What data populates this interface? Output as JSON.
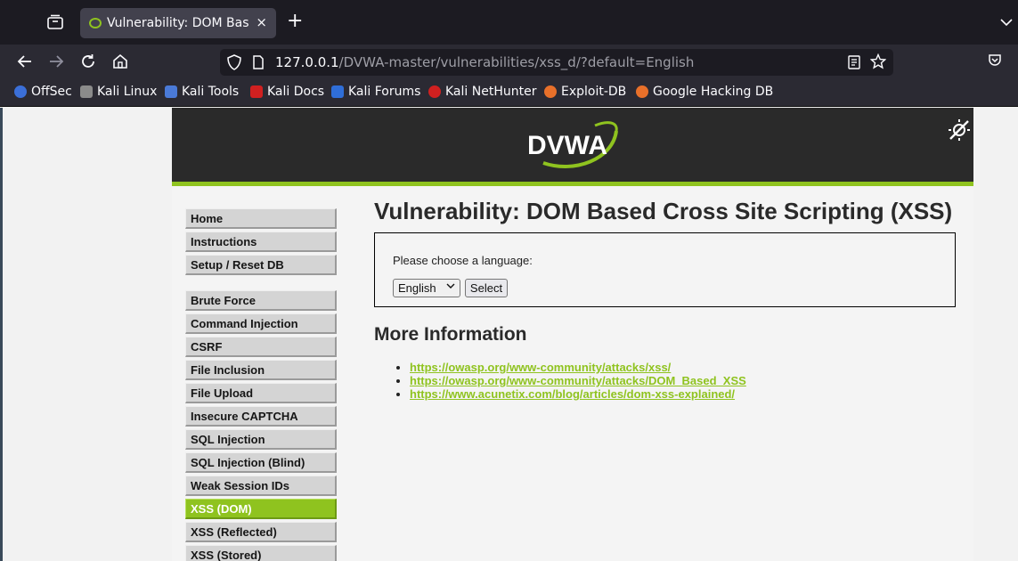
{
  "browser": {
    "tab_title": "Vulnerability: DOM Based Cross Site Scripting (XSS)",
    "url_host": "127.0.0.1",
    "url_path": "/DVWA-master/vulnerabilities/xss_d/?default=English",
    "new_tab_label": "+",
    "close_tab_label": "×"
  },
  "bookmarks": [
    {
      "label": "OffSec",
      "color": "#3b6fd8"
    },
    {
      "label": "Kali Linux",
      "color": "#8b8b8b"
    },
    {
      "label": "Kali Tools",
      "color": "#4a7ad8"
    },
    {
      "label": "Kali Docs",
      "color": "#d02020"
    },
    {
      "label": "Kali Forums",
      "color": "#2f6ed8"
    },
    {
      "label": "Kali NetHunter",
      "color": "#d02020"
    },
    {
      "label": "Exploit-DB",
      "color": "#e8702a"
    },
    {
      "label": "Google Hacking DB",
      "color": "#e8702a"
    }
  ],
  "logo": {
    "text": "DVWA"
  },
  "menu": {
    "group1": [
      "Home",
      "Instructions",
      "Setup / Reset DB"
    ],
    "group2": [
      "Brute Force",
      "Command Injection",
      "CSRF",
      "File Inclusion",
      "File Upload",
      "Insecure CAPTCHA",
      "SQL Injection",
      "SQL Injection (Blind)",
      "Weak Session IDs",
      "XSS (DOM)",
      "XSS (Reflected)",
      "XSS (Stored)"
    ],
    "active": "XSS (DOM)"
  },
  "main": {
    "title": "Vulnerability: DOM Based Cross Site Scripting (XSS)",
    "prompt": "Please choose a language:",
    "language_selected": "English",
    "select_button": "Select",
    "more_info_title": "More Information",
    "links": [
      "https://owasp.org/www-community/attacks/xss/",
      "https://owasp.org/www-community/attacks/DOM_Based_XSS",
      "https://www.acunetix.com/blog/articles/dom-xss-explained/"
    ]
  },
  "colors": {
    "accent": "#8fc31f",
    "header": "#2a2a2a"
  }
}
